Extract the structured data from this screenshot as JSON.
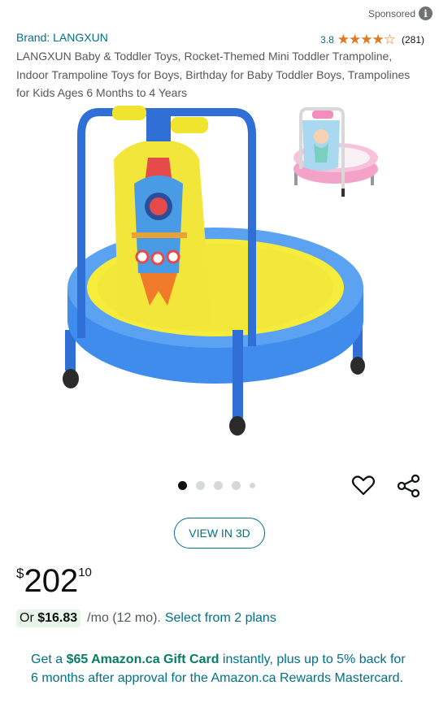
{
  "sponsored": {
    "label": "Sponsored",
    "icon": "info-icon"
  },
  "product": {
    "brand": "Brand: LANGXUN",
    "rating": "3.8",
    "stars": "★★★★☆",
    "rating_count": "(281)",
    "title": "LANGXUN Baby & Toddler Toys, Rocket-Themed Mini Toddler Trampoline, Indoor Trampoline Toys for Boys, Birthday for Baby Toddler Boys, Trampolines for Kids Ages 6 Months to 4 Years"
  },
  "gallery": {
    "image_count": 5,
    "active_index": 0
  },
  "actions": {
    "view3d": "VIEW IN 3D",
    "favorite_icon": "heart-icon",
    "share_icon": "share-icon"
  },
  "price": {
    "symbol": "$",
    "whole": "202",
    "fraction": "10"
  },
  "financing": {
    "prefix": "Or",
    "amount": "$16.83",
    "term": "/mo (12 mo).",
    "link": "Select from 2 plans"
  },
  "promo": {
    "part1": "Get a ",
    "highlight": "$65 Amazon.ca Gift Card",
    "part2": " instantly, plus up to 5% back for 6 months after approval for the Amazon.ca Rewards Mastercard."
  },
  "colors": {
    "link": "#007185",
    "star": "#de7921",
    "green": "#067d62"
  }
}
